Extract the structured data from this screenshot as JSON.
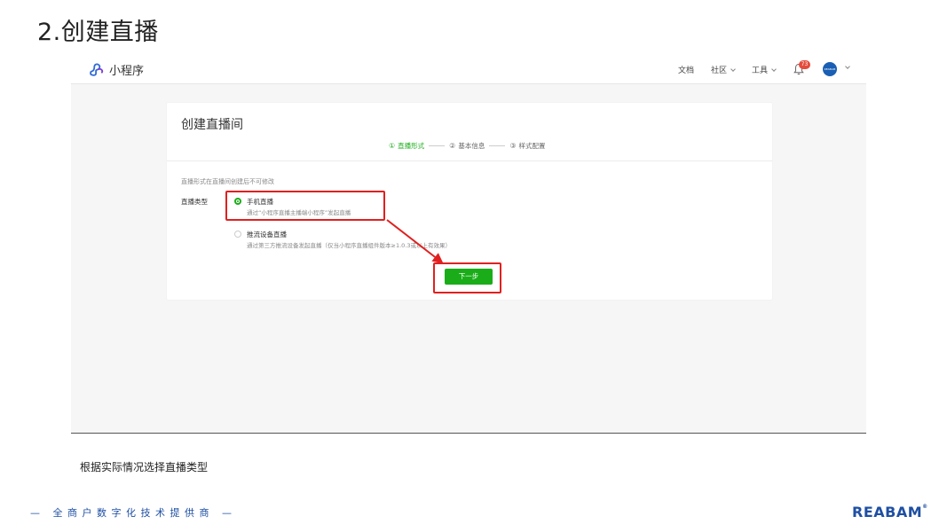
{
  "slide": {
    "title": "2.创建直播",
    "caption": "根据实际情况选择直播类型",
    "footer_tagline": "— 全商户数字化技术提供商 —",
    "footer_brand": "REABAM",
    "footer_brand_mark": "®"
  },
  "topbar": {
    "app_name": "小程序",
    "nav": [
      {
        "label": "文档",
        "has_dropdown": false
      },
      {
        "label": "社区",
        "has_dropdown": true
      },
      {
        "label": "工具",
        "has_dropdown": true
      }
    ],
    "notification_count": "73",
    "avatar_text": "REABAM"
  },
  "card": {
    "title": "创建直播间",
    "steps": [
      {
        "num": "①",
        "label": "直播形式",
        "active": true
      },
      {
        "num": "②",
        "label": "基本信息",
        "active": false
      },
      {
        "num": "③",
        "label": "样式配置",
        "active": false
      }
    ],
    "hint": "直播形式在直播间创建后不可修改",
    "type_label": "直播类型",
    "options": [
      {
        "title": "手机直播",
        "desc": "通过“小程序直播主播端小程序”发起直播",
        "checked": true
      },
      {
        "title": "推流设备直播",
        "desc": "通过第三方推流设备发起直播（仅当小程序直播组件版本≥1.0.3或以上有效果）",
        "checked": false
      }
    ],
    "next_label": "下一步"
  },
  "colors": {
    "accent_green": "#1aad19",
    "highlight_red": "#e02020",
    "brand_blue": "#1e4fa3",
    "badge_red": "#e54c3c"
  },
  "icons": [
    "mini-program-logo-icon",
    "chevron-down-icon",
    "bell-icon",
    "avatar"
  ]
}
